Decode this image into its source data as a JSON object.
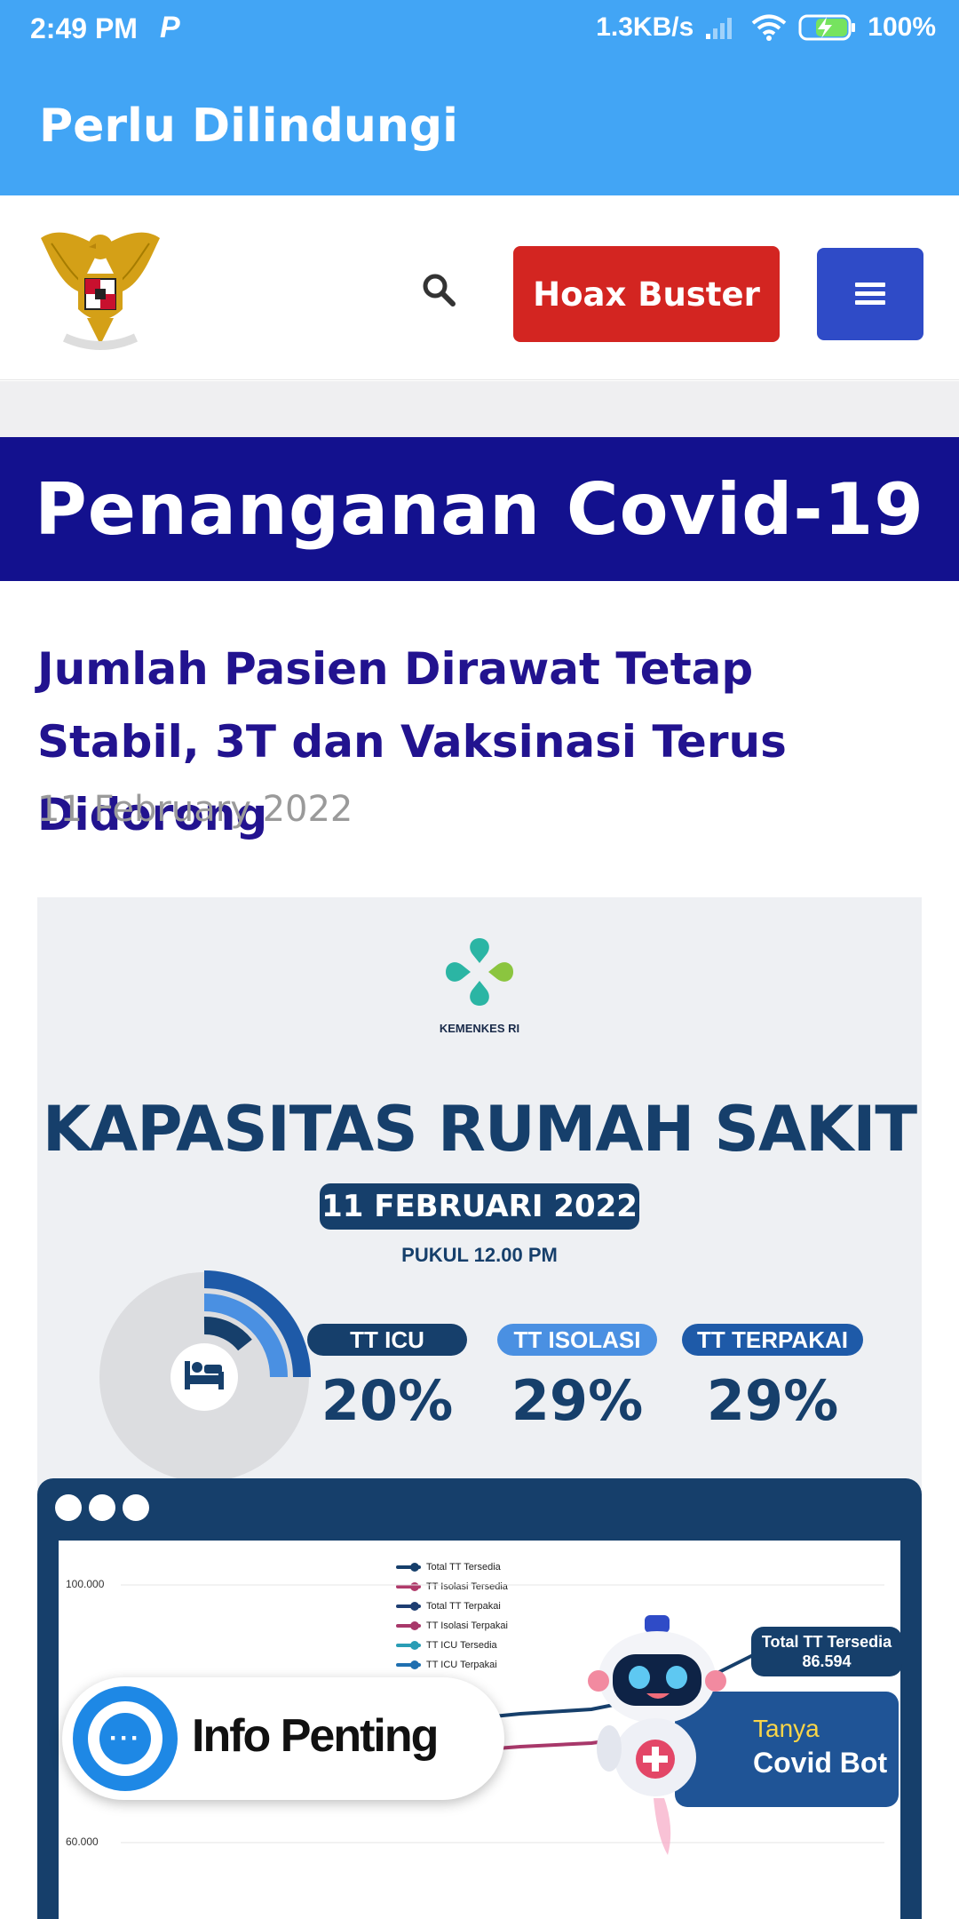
{
  "status_bar": {
    "time": "2:49 PM",
    "app_indicator": "P",
    "network_speed": "1.3KB/s",
    "battery": "100%"
  },
  "app_bar": {
    "title": "Perlu Dilindungi"
  },
  "header": {
    "hoax_button": "Hoax Buster",
    "icons": [
      "garuda-emblem",
      "search-icon",
      "hamburger-menu-icon"
    ]
  },
  "banner": {
    "title": "Penanganan Covid-19"
  },
  "article": {
    "title": "Jumlah Pasien Dirawat Tetap Stabil, 3T dan Vaksinasi Terus Didorong",
    "date": "11 February 2022"
  },
  "infographic": {
    "org": "KEMENKES RI",
    "heading": "KAPASITAS RUMAH SAKIT",
    "date": "11 FEBRUARI 2022",
    "time": "PUKUL 12.00 PM",
    "stats": [
      {
        "label": "TT ICU",
        "value": "20%",
        "color": "#163F6B"
      },
      {
        "label": "TT ISOLASI",
        "value": "29%",
        "color": "#4A90E2"
      },
      {
        "label": "TT TERPAKAI",
        "value": "29%",
        "color": "#1E5AA8"
      }
    ],
    "chart": {
      "y_ticks": [
        "100.000",
        "60.000"
      ],
      "legend": [
        "Total TT Tersedia",
        "TT Isolasi Tersedia",
        "Total TT Terpakai",
        "TT Isolasi Terpakai",
        "TT ICU Tersedia",
        "TT ICU Terpakai"
      ],
      "legend_colors": [
        "#163F6B",
        "#B03A6A",
        "#1E3E72",
        "#A8386A",
        "#2A9DB5",
        "#1F6FB0"
      ],
      "callout_label": "Total TT Tersedia",
      "callout_value": "86.594"
    }
  },
  "widgets": {
    "info_penting": "Info Penting",
    "bot_prompt": "Tanya",
    "bot_name": "Covid Bot"
  }
}
